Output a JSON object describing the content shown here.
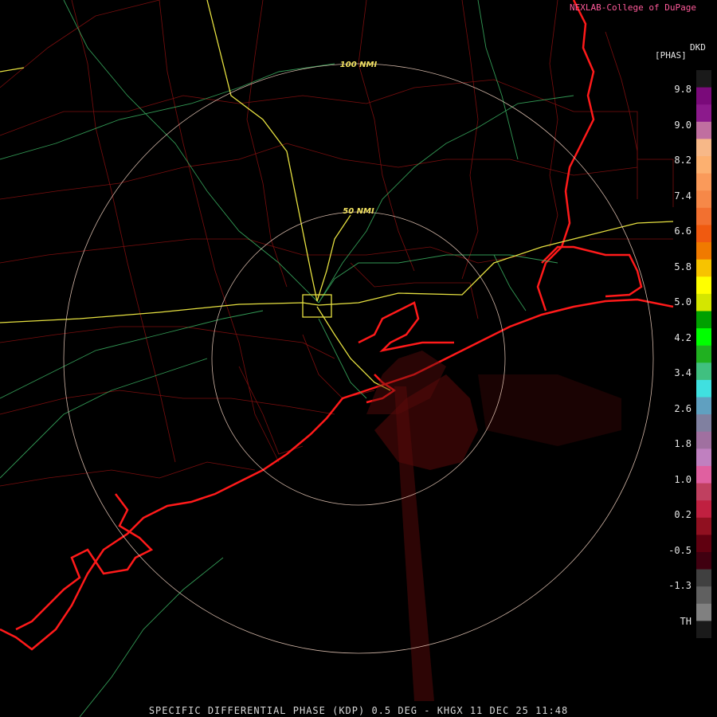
{
  "credit": "NEXLAB-College of DuPage",
  "legend": {
    "product_code": "DKD",
    "unit": "[PHAS]",
    "labels": [
      "9.8",
      "9.0",
      "8.2",
      "7.4",
      "6.6",
      "5.8",
      "5.0",
      "4.2",
      "3.4",
      "2.6",
      "1.8",
      "1.0",
      "0.2",
      "-0.5",
      "-1.3",
      "TH"
    ],
    "colors": [
      "#1a1a1a",
      "#7a0a7a",
      "#8c1a8c",
      "#c06fa0",
      "#f7b888",
      "#fcb070",
      "#fa9a5a",
      "#f68848",
      "#f27030",
      "#f05a10",
      "#f07a00",
      "#f7c300",
      "#ffff00",
      "#d4e600",
      "#00a000",
      "#00ff00",
      "#20b020",
      "#40c080",
      "#40e0e0",
      "#60a0c0",
      "#8080a0",
      "#a070a0",
      "#c080c0",
      "#e060a0",
      "#c04060",
      "#c02040",
      "#901020",
      "#600010",
      "#400010",
      "#404040",
      "#606060",
      "#808080",
      "#1a1a1a"
    ]
  },
  "range_rings": [
    {
      "label": "100 NMI"
    },
    {
      "label": "50 NMI"
    }
  ],
  "footer": "SPECIFIC DIFFERENTIAL PHASE (KDP) 0.5 DEG - KHGX 11 DEC 25 11:48"
}
